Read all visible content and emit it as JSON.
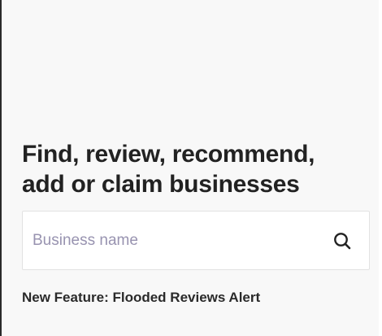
{
  "hero": {
    "headline": "Find, review, recommend, add or claim businesses"
  },
  "search": {
    "placeholder": "Business name",
    "value": "",
    "button_icon": "search-icon"
  },
  "feature": {
    "text": "New Feature: Flooded Reviews Alert"
  },
  "colors": {
    "background": "#f8f8f8",
    "text": "#222222",
    "placeholder": "#9893b0",
    "border": "#e2e2e2"
  }
}
